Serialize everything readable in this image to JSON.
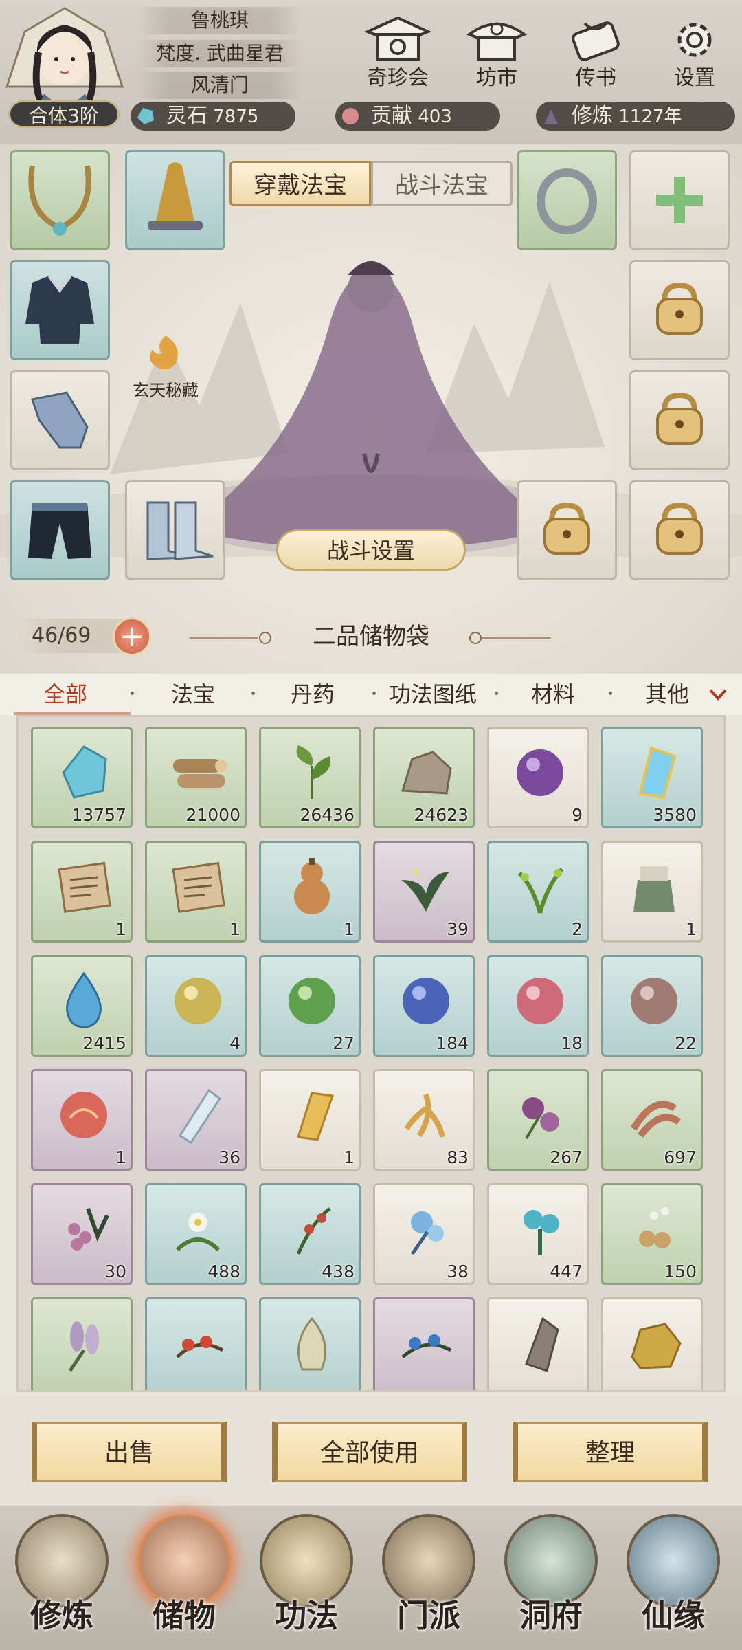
{
  "player": {
    "name": "鲁桃琪",
    "title": "梵度. 武曲星君",
    "sect": "风清门",
    "realm": "合体3阶"
  },
  "top_buttons": [
    {
      "label": "奇珍会",
      "icon": "treasure-pavilion-icon"
    },
    {
      "label": "坊市",
      "icon": "market-icon"
    },
    {
      "label": "传书",
      "icon": "letter-scroll-icon"
    },
    {
      "label": "设置",
      "icon": "gear-icon"
    }
  ],
  "resources": {
    "spirit_stone": {
      "label": "灵石",
      "value": "7875"
    },
    "contribution": {
      "label": "贡献",
      "value": "403"
    },
    "cultivation": {
      "label": "修炼",
      "value": "1127年"
    }
  },
  "equip_tabs": {
    "worn": "穿戴法宝",
    "battle": "战斗法宝"
  },
  "secret_label": "玄天秘藏",
  "fight_setting": "战斗设置",
  "bag": {
    "capacity": "46/69",
    "title": "二品储物袋"
  },
  "categories": [
    "全部",
    "法宝",
    "丹药",
    "功法图纸",
    "材料",
    "其他"
  ],
  "items": [
    {
      "icon": "blue-crystal-icon",
      "qty": "13757",
      "rarity": "green"
    },
    {
      "icon": "wood-logs-icon",
      "qty": "21000",
      "rarity": "green"
    },
    {
      "icon": "herb-leaf-icon",
      "qty": "26436",
      "rarity": "green"
    },
    {
      "icon": "ore-rock-icon",
      "qty": "24623",
      "rarity": "green"
    },
    {
      "icon": "purple-orb-icon",
      "qty": "9",
      "rarity": "white"
    },
    {
      "icon": "glowing-crystal-icon",
      "qty": "3580",
      "rarity": "blue"
    },
    {
      "icon": "scroll-map-icon",
      "qty": "1",
      "rarity": "green"
    },
    {
      "icon": "scroll-map-icon",
      "qty": "1",
      "rarity": "green"
    },
    {
      "icon": "gourd-icon",
      "qty": "1",
      "rarity": "blue"
    },
    {
      "icon": "dark-herb-icon",
      "qty": "39",
      "rarity": "purple"
    },
    {
      "icon": "green-herb-icon",
      "qty": "2",
      "rarity": "blue"
    },
    {
      "icon": "sealed-jar-icon",
      "qty": "1",
      "rarity": "white"
    },
    {
      "icon": "water-drop-icon",
      "qty": "2415",
      "rarity": "green"
    },
    {
      "icon": "yellow-orb-icon",
      "qty": "4",
      "rarity": "blue"
    },
    {
      "icon": "green-orb-icon",
      "qty": "27",
      "rarity": "blue"
    },
    {
      "icon": "blue-orb-icon",
      "qty": "184",
      "rarity": "blue"
    },
    {
      "icon": "pink-orb-icon",
      "qty": "18",
      "rarity": "blue"
    },
    {
      "icon": "brown-orb-icon",
      "qty": "22",
      "rarity": "blue"
    },
    {
      "icon": "fire-orb-icon",
      "qty": "1",
      "rarity": "purple"
    },
    {
      "icon": "ice-crystal-icon",
      "qty": "36",
      "rarity": "purple"
    },
    {
      "icon": "talisman-paper-icon",
      "qty": "1",
      "rarity": "white"
    },
    {
      "icon": "ginseng-root-icon",
      "qty": "83",
      "rarity": "white"
    },
    {
      "icon": "purple-flower-icon",
      "qty": "267",
      "rarity": "green"
    },
    {
      "icon": "red-root-icon",
      "qty": "697",
      "rarity": "green"
    },
    {
      "icon": "berry-plant-icon",
      "qty": "30",
      "rarity": "purple"
    },
    {
      "icon": "white-flower-icon",
      "qty": "488",
      "rarity": "blue"
    },
    {
      "icon": "red-berry-herb-icon",
      "qty": "438",
      "rarity": "blue"
    },
    {
      "icon": "blue-flower-icon",
      "qty": "38",
      "rarity": "white"
    },
    {
      "icon": "cyan-flower-icon",
      "qty": "447",
      "rarity": "white"
    },
    {
      "icon": "mushroom-flower-icon",
      "qty": "150",
      "rarity": "green"
    },
    {
      "icon": "lavender-icon",
      "qty": "",
      "rarity": "green"
    },
    {
      "icon": "red-fruit-branch-icon",
      "qty": "",
      "rarity": "blue"
    },
    {
      "icon": "pine-cone-icon",
      "qty": "",
      "rarity": "blue"
    },
    {
      "icon": "blue-berry-branch-icon",
      "qty": "",
      "rarity": "purple"
    },
    {
      "icon": "stone-shard-icon",
      "qty": "",
      "rarity": "white"
    },
    {
      "icon": "gold-ore-icon",
      "qty": "",
      "rarity": "white"
    }
  ],
  "actions": {
    "sell": "出售",
    "use_all": "全部使用",
    "sort": "整理"
  },
  "nav": [
    {
      "label": "修炼",
      "icon": "cultivate-icon"
    },
    {
      "label": "储物",
      "icon": "storage-bag-icon",
      "active": true
    },
    {
      "label": "功法",
      "icon": "technique-book-icon"
    },
    {
      "label": "门派",
      "icon": "sect-gate-icon"
    },
    {
      "label": "洞府",
      "icon": "cave-mountain-icon"
    },
    {
      "label": "仙缘",
      "icon": "immortal-fate-icon"
    }
  ],
  "colors": {
    "active_tab": "#b43a22",
    "gold": "#c8a764"
  }
}
